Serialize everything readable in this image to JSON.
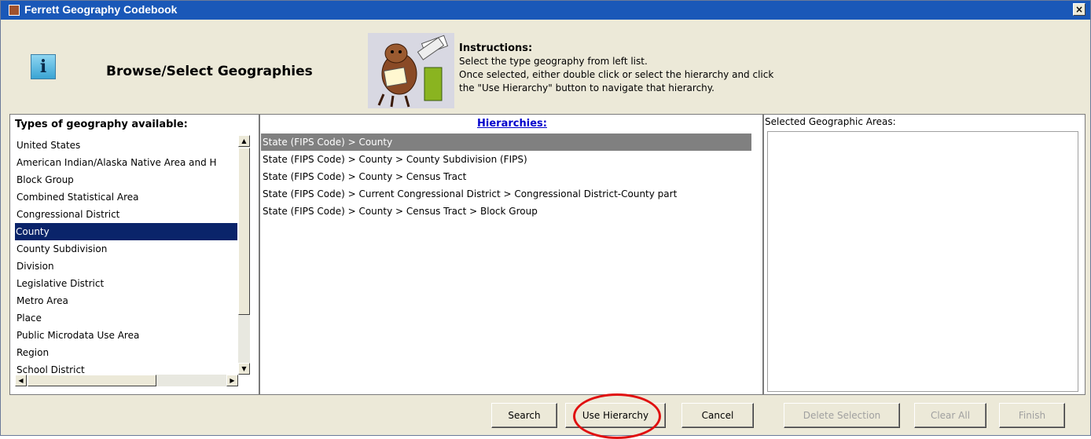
{
  "window": {
    "title": "Ferrett Geography Codebook",
    "close_label": "×"
  },
  "header": {
    "title": "Browse/Select Geographies",
    "info_icon": "i",
    "instructions_heading": "Instructions:",
    "instructions_lines": [
      "Select the type geography from left list.",
      "Once selected, either double click or select the hierarchy and click",
      "the \"Use Hierarchy\" button to navigate that hierarchy."
    ]
  },
  "types": {
    "header": "Types of geography available:",
    "items": [
      "United States",
      "American Indian/Alaska Native Area and H",
      "Block Group",
      "Combined Statistical Area",
      "Congressional District",
      "County",
      "County Subdivision",
      "Division",
      "Legislative District",
      "Metro Area",
      "Place",
      "Public Microdata Use Area",
      "Region",
      "School District"
    ],
    "selected": "County"
  },
  "hierarchies": {
    "header": "Hierarchies:",
    "items": [
      "State (FIPS Code) > County",
      "State (FIPS Code) > County > County Subdivision (FIPS)",
      "State (FIPS Code) > County > Census Tract",
      "State (FIPS Code) > Current Congressional District > Congressional District-County part",
      "State (FIPS Code) > County > Census Tract > Block Group"
    ],
    "selected": "State (FIPS Code) > County"
  },
  "selected_areas": {
    "header": "Selected Geographic Areas:"
  },
  "buttons": {
    "search": "Search",
    "use_hierarchy": "Use Hierarchy",
    "cancel": "Cancel",
    "delete_selection": "Delete Selection",
    "clear_all": "Clear All",
    "finish": "Finish"
  },
  "colors": {
    "titlebar": "#1a58b8",
    "selection": "#0a246a",
    "hier_selection": "#808080",
    "annotation_circle": "#e01010"
  }
}
